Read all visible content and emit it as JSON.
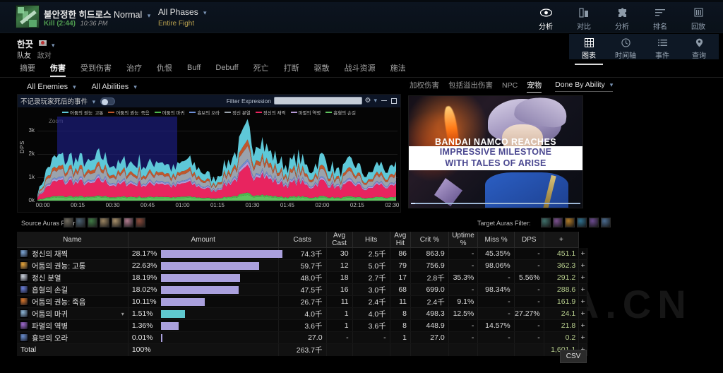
{
  "header": {
    "boss_name": "불안정한 히드로스",
    "difficulty": "Normal",
    "kill_label": "Kill (2:44)",
    "kill_time": "10:36 PM",
    "phases": "All Phases",
    "phases_sub": "Entire Fight",
    "nav": [
      {
        "label": "分析",
        "icon": "eye-icon",
        "active": true
      },
      {
        "label": "对比",
        "icon": "compare-icon",
        "active": false
      },
      {
        "label": "分析",
        "icon": "puzzle-icon",
        "active": false
      },
      {
        "label": "排名",
        "icon": "rank-icon",
        "active": false
      },
      {
        "label": "回放",
        "icon": "replay-icon",
        "active": false
      }
    ]
  },
  "player": {
    "name": "한끗",
    "team_label": "队友",
    "opponent_label": "敌对",
    "subnav": [
      {
        "label": "图表",
        "icon": "grid-icon",
        "active": true
      },
      {
        "label": "时间轴",
        "icon": "clock-icon",
        "active": false
      },
      {
        "label": "事件",
        "icon": "list-icon",
        "active": false
      },
      {
        "label": "查询",
        "icon": "pin-icon",
        "active": false
      }
    ]
  },
  "tabs": [
    {
      "label": "摘要",
      "active": false
    },
    {
      "label": "伤害",
      "active": true
    },
    {
      "label": "受到伤害",
      "active": false
    },
    {
      "label": "治疗",
      "active": false
    },
    {
      "label": "仇恨",
      "active": false
    },
    {
      "label": "Buff",
      "active": false
    },
    {
      "label": "Debuff",
      "active": false
    },
    {
      "label": "死亡",
      "active": false
    },
    {
      "label": "打断",
      "active": false
    },
    {
      "label": "驱散",
      "active": false
    },
    {
      "label": "战斗资源",
      "active": false
    },
    {
      "label": "施法",
      "active": false
    }
  ],
  "filters": {
    "enemies": "All Enemies",
    "abilities": "All Abilities"
  },
  "chart_panel": {
    "death_filter": "不记录玩家死后的事件",
    "filter_expression_label": "Filter Expression",
    "filter_expression_value": "",
    "zoom_label": "Zoom"
  },
  "right_panel": {
    "tabs": [
      {
        "label": "加权伤害",
        "active": false
      },
      {
        "label": "包括溢出伤害",
        "active": false
      },
      {
        "label": "NPC",
        "active": false
      },
      {
        "label": "宠物",
        "active": true
      }
    ],
    "dropdown": "Done By Ability",
    "ad": {
      "line1": "BANDAI NAMCO REACHES",
      "line2": "IMPRESSIVE MILESTONE",
      "line3": "WITH TALES OF ARISE"
    }
  },
  "aura_filters": {
    "source_label": "Source Auras Filter:",
    "target_label": "Target Auras Filter:",
    "source_icons": [
      "aura-icon-1",
      "aura-icon-2",
      "aura-icon-3",
      "aura-icon-4",
      "aura-icon-5",
      "aura-icon-6",
      "aura-icon-7"
    ],
    "target_icons": [
      "target-aura-1",
      "target-aura-2",
      "target-aura-3",
      "target-aura-4",
      "target-aura-5",
      "target-aura-6"
    ]
  },
  "chart_data": {
    "type": "area",
    "title": "",
    "xlabel": "",
    "ylabel": "DPS",
    "ylim": [
      0,
      3600
    ],
    "yticks": [
      "0k",
      "1k",
      "2k",
      "3k"
    ],
    "ytick_values": [
      0,
      1000,
      2000,
      3000
    ],
    "xticks": [
      "00:00",
      "00:15",
      "00:30",
      "00:45",
      "01:00",
      "01:15",
      "01:30",
      "01:45",
      "02:00",
      "02:15",
      "02:30"
    ],
    "grid": true,
    "legend_position": "top",
    "zoom_selection": {
      "from": "00:05",
      "to": "00:48",
      "top": 3600
    },
    "series": [
      {
        "name": "어둠의 권능: 고통",
        "color": "#5ec8d8"
      },
      {
        "name": "어둠의 권능: 죽음",
        "color": "#c0572c"
      },
      {
        "name": "어둠의 마귀",
        "color": "#4eb84e"
      },
      {
        "name": "흉보의 오라",
        "color": "#6d8fd6"
      },
      {
        "name": "정신 분열",
        "color": "#9aa3ad"
      },
      {
        "name": "정신의 채찍",
        "color": "#e8245f"
      },
      {
        "name": "파멸의 역병",
        "color": "#b59ad6"
      },
      {
        "name": "흡혈의 손길",
        "color": "#5ec25e"
      }
    ]
  },
  "table": {
    "columns": [
      "Name",
      "Amount",
      "Casts",
      "Avg Cast",
      "Hits",
      "Avg Hit",
      "Crit %",
      "Uptime %",
      "Miss %",
      "DPS",
      "+"
    ],
    "rows": [
      {
        "name": "정신의 채찍",
        "pct": "28.17%",
        "bar": 97,
        "amount": "74.3千",
        "casts": "30",
        "avg_cast": "2.5千",
        "hits": "86",
        "avg_hit": "863.9",
        "crit": "-",
        "uptime": "45.35%",
        "miss": "-",
        "dps": "451.1",
        "plus": "+"
      },
      {
        "name": "어둠의 권능: 고통",
        "pct": "22.63%",
        "bar": 78,
        "amount": "59.7千",
        "casts": "12",
        "avg_cast": "5.0千",
        "hits": "79",
        "avg_hit": "756.9",
        "crit": "-",
        "uptime": "98.06%",
        "miss": "-",
        "dps": "362.3",
        "plus": "+"
      },
      {
        "name": "정신 분열",
        "pct": "18.19%",
        "bar": 63,
        "amount": "48.0千",
        "casts": "18",
        "avg_cast": "2.7千",
        "hits": "17",
        "avg_hit": "2.8千",
        "crit": "35.3%",
        "uptime": "-",
        "miss": "5.56%",
        "dps": "291.2",
        "plus": "+"
      },
      {
        "name": "흡혈의 손길",
        "pct": "18.02%",
        "bar": 62,
        "amount": "47.5千",
        "casts": "16",
        "avg_cast": "3.0千",
        "hits": "68",
        "avg_hit": "699.0",
        "crit": "-",
        "uptime": "98.34%",
        "miss": "-",
        "dps": "288.6",
        "plus": "+"
      },
      {
        "name": "어둠의 권능: 죽음",
        "pct": "10.11%",
        "bar": 35,
        "amount": "26.7千",
        "casts": "11",
        "avg_cast": "2.4千",
        "hits": "11",
        "avg_hit": "2.4千",
        "crit": "9.1%",
        "uptime": "-",
        "miss": "-",
        "dps": "161.9",
        "plus": "+"
      },
      {
        "name": "어둠의 마귀",
        "pct": "1.51%",
        "bar": 19,
        "amount": "4.0千",
        "casts": "1",
        "avg_cast": "4.0千",
        "hits": "8",
        "avg_hit": "498.3",
        "crit": "12.5%",
        "uptime": "-",
        "miss": "27.27%",
        "dps": "24.1",
        "plus": "+"
      },
      {
        "name": "파멸의 역병",
        "pct": "1.36%",
        "bar": 14,
        "amount": "3.6千",
        "casts": "1",
        "avg_cast": "3.6千",
        "hits": "8",
        "avg_hit": "448.9",
        "crit": "-",
        "uptime": "14.57%",
        "miss": "-",
        "dps": "21.8",
        "plus": "+"
      },
      {
        "name": "흉보의 오라",
        "pct": "0.01%",
        "bar": 1,
        "amount": "27.0",
        "casts": "-",
        "avg_cast": "-",
        "hits": "1",
        "avg_hit": "27.0",
        "crit": "-",
        "uptime": "-",
        "miss": "-",
        "dps": "0.2",
        "plus": "+"
      }
    ],
    "total": {
      "label": "Total",
      "pct": "100%",
      "amount": "263.7千",
      "dps": "1,601.1",
      "plus": "+"
    }
  },
  "footer": {
    "csv_label": "CSV"
  },
  "watermark": "BBS.NGA.CN"
}
